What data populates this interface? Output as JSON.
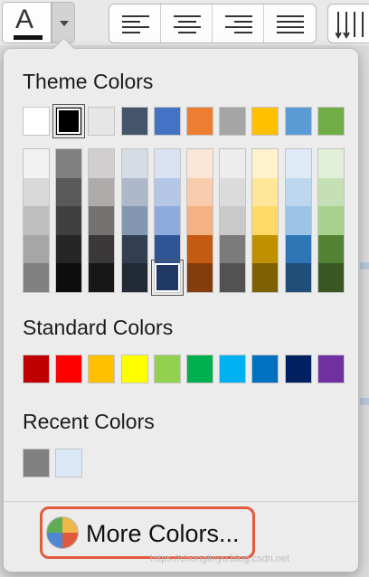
{
  "toolbar": {
    "font_color_glyph": "A",
    "font_color_bar": "#111111"
  },
  "popup": {
    "theme_title": "Theme Colors",
    "standard_title": "Standard Colors",
    "recent_title": "Recent Colors",
    "more_colors_label": "More Colors...",
    "watermark": "https://chonglinyu.blog.csdn.net"
  },
  "theme_colors": [
    "#ffffff",
    "#000000",
    "#e7e6e6",
    "#44546a",
    "#4472c4",
    "#ed7d31",
    "#a5a5a5",
    "#ffc000",
    "#5b9bd5",
    "#70ad47"
  ],
  "theme_tints": [
    [
      "#f2f2f2",
      "#d9d9d9",
      "#bfbfbf",
      "#a6a6a6",
      "#808080"
    ],
    [
      "#808080",
      "#595959",
      "#404040",
      "#262626",
      "#0d0d0d"
    ],
    [
      "#d0cece",
      "#aeabab",
      "#767171",
      "#3a3838",
      "#171717"
    ],
    [
      "#d6dce5",
      "#adb9ca",
      "#8497b0",
      "#333f50",
      "#222a35"
    ],
    [
      "#dae3f3",
      "#b4c7e7",
      "#8faadc",
      "#2f5597",
      "#1f3864"
    ],
    [
      "#fbe5d6",
      "#f8cbad",
      "#f4b183",
      "#c55a11",
      "#843c0c"
    ],
    [
      "#ededed",
      "#dbdbdb",
      "#c9c9c9",
      "#7b7b7b",
      "#525252"
    ],
    [
      "#fff2cc",
      "#ffe699",
      "#ffd966",
      "#bf9000",
      "#7f6000"
    ],
    [
      "#deebf7",
      "#bdd7ee",
      "#9dc3e6",
      "#2e75b6",
      "#1f4e79"
    ],
    [
      "#e2f0d9",
      "#c5e0b4",
      "#a9d18e",
      "#548235",
      "#385723"
    ]
  ],
  "selected_theme_index": 1,
  "selected_tint": [
    4,
    4
  ],
  "standard_colors": [
    "#c00000",
    "#ff0000",
    "#ffc000",
    "#ffff00",
    "#92d050",
    "#00b050",
    "#00b0f0",
    "#0070c0",
    "#002060",
    "#7030a0"
  ],
  "recent_colors": [
    "#808080",
    "#dae8f8"
  ]
}
